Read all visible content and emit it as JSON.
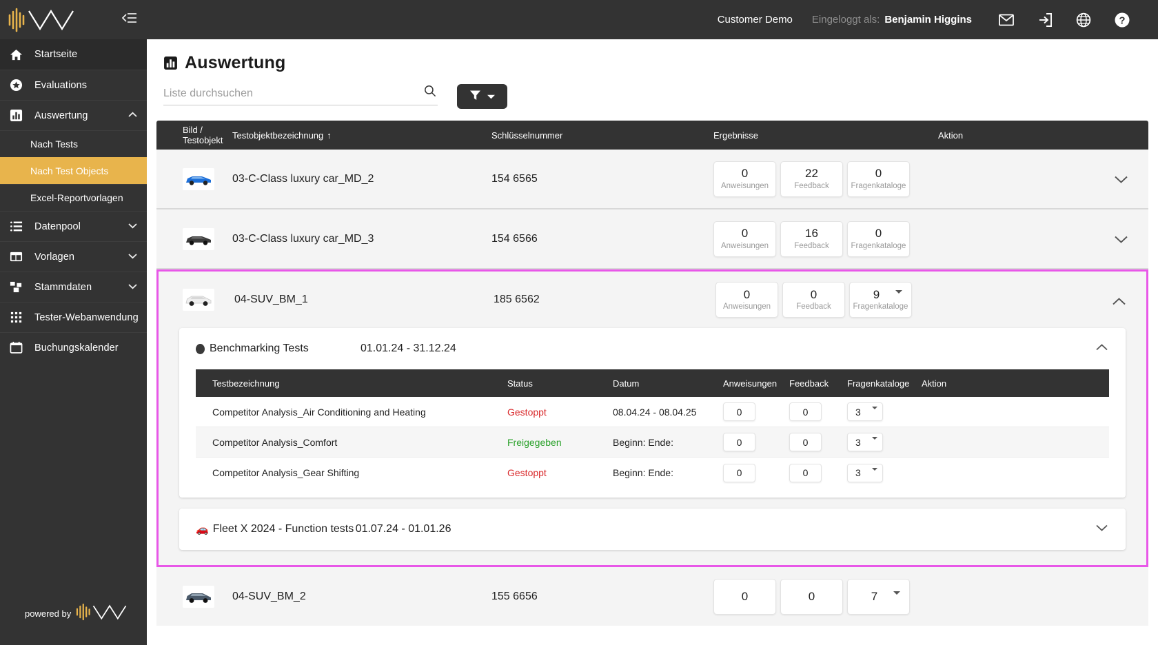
{
  "sidebar": {
    "logo_alt": "brand-logo",
    "collapse_icon": "collapse-sidebar-icon",
    "items": [
      {
        "label": "Startseite",
        "icon": "home-icon",
        "expandable": false
      },
      {
        "label": "Evaluations",
        "icon": "star-icon",
        "expandable": false
      },
      {
        "label": "Auswertung",
        "icon": "bar-chart-icon",
        "expandable": true,
        "expanded": true
      }
    ],
    "subitems": [
      {
        "label": "Nach Tests",
        "active": false
      },
      {
        "label": "Nach Test Objects",
        "active": true
      },
      {
        "label": "Excel-Reportvorlagen",
        "active": false
      }
    ],
    "items2": [
      {
        "label": "Datenpool",
        "icon": "list-icon",
        "expandable": true
      },
      {
        "label": "Vorlagen",
        "icon": "template-icon",
        "expandable": true
      },
      {
        "label": "Stammdaten",
        "icon": "hierarchy-icon",
        "expandable": true
      },
      {
        "label": "Tester-Webanwendung",
        "icon": "grid-icon",
        "expandable": false
      },
      {
        "label": "Buchungskalender",
        "icon": "calendar-icon",
        "expandable": false
      }
    ],
    "footer": {
      "powered_by": "powered by"
    }
  },
  "topbar": {
    "customer": "Customer Demo",
    "logged_in_label": "Eingeloggt als:",
    "user_name": "Benjamin Higgins",
    "icons": [
      "mail-icon",
      "logout-icon",
      "globe-icon",
      "help-icon"
    ]
  },
  "page": {
    "title": "Auswertung",
    "title_icon": "bar-chart-icon"
  },
  "search": {
    "placeholder": "Liste durchsuchen",
    "value": "",
    "icon": "search-icon"
  },
  "filter_button": {
    "icon": "filter-icon",
    "caret": "chevron-down-icon"
  },
  "table": {
    "columns": [
      "Bild / Testobjekt",
      "Testobjektbezeichnung",
      "Schlüsselnummer",
      "Ergebnisse",
      "Aktion"
    ],
    "sort_indicator": "↑",
    "sorted_column": "Testobjektbezeichnung",
    "rows": [
      {
        "name": "03-C-Class luxury car_MD_2",
        "key_number": "154 6565",
        "thumb_color": "#1d6fd8",
        "results": [
          {
            "value": "0",
            "label": "Anweisungen",
            "dropdown": false
          },
          {
            "value": "22",
            "label": "Feedback",
            "dropdown": false
          },
          {
            "value": "0",
            "label": "Fragenkataloge",
            "dropdown": false
          }
        ],
        "expanded": false,
        "selected": false
      },
      {
        "name": "03-C-Class luxury car_MD_3",
        "key_number": "154 6566",
        "thumb_color": "#3a3a3a",
        "results": [
          {
            "value": "0",
            "label": "Anweisungen",
            "dropdown": false
          },
          {
            "value": "16",
            "label": "Feedback",
            "dropdown": false
          },
          {
            "value": "0",
            "label": "Fragenkataloge",
            "dropdown": false
          }
        ],
        "expanded": false,
        "selected": false
      },
      {
        "name": "04-SUV_BM_1",
        "key_number": "185 6562",
        "thumb_color": "#e8e8e8",
        "results": [
          {
            "value": "0",
            "label": "Anweisungen",
            "dropdown": false
          },
          {
            "value": "0",
            "label": "Feedback",
            "dropdown": false
          },
          {
            "value": "9",
            "label": "Fragenkataloge",
            "dropdown": true
          }
        ],
        "expanded": true,
        "selected": true
      },
      {
        "name": "04-SUV_BM_2",
        "key_number": "155 6656",
        "thumb_color": "#4a5a6a",
        "results": [
          {
            "value": "0",
            "label": "",
            "dropdown": false
          },
          {
            "value": "0",
            "label": "",
            "dropdown": false
          },
          {
            "value": "7",
            "label": "",
            "dropdown": true
          }
        ],
        "expanded": false,
        "selected": false
      }
    ]
  },
  "expanded_panel": {
    "groups": [
      {
        "marker": "dot",
        "title": "Benchmarking Tests",
        "date_range": "01.01.24 - 31.12.24",
        "expanded": true,
        "sub_columns": [
          "Testbezeichnung",
          "Status",
          "Datum",
          "Anweisungen",
          "Feedback",
          "Fragenkataloge",
          "Aktion"
        ],
        "sub_rows": [
          {
            "name": "Competitor Analysis_Air Conditioning and Heating",
            "status": "Gestoppt",
            "status_type": "stopped",
            "date": "08.04.24 - 08.04.25",
            "anweisungen": "0",
            "feedback": "0",
            "fragenkataloge": "3"
          },
          {
            "name": "Competitor Analysis_Comfort",
            "status": "Freigegeben",
            "status_type": "released",
            "date": "Beginn: Ende:",
            "anweisungen": "0",
            "feedback": "0",
            "fragenkataloge": "3"
          },
          {
            "name": "Competitor Analysis_Gear Shifting",
            "status": "Gestoppt",
            "status_type": "stopped",
            "date": "Beginn: Ende:",
            "anweisungen": "0",
            "feedback": "0",
            "fragenkataloge": "3"
          }
        ]
      },
      {
        "marker": "car",
        "marker_emoji": "🚗",
        "title": "Fleet X 2024 - Function tests",
        "date_range": "01.07.24 - 01.01.26",
        "expanded": false,
        "sub_columns": [],
        "sub_rows": []
      }
    ]
  },
  "colors": {
    "sidebar_bg": "#333333",
    "accent_yellow": "#e8b44c",
    "selection_magenta": "#e857e8",
    "status_stopped": "#d9292b",
    "status_released": "#2aa12a",
    "row_bg": "#f4f4f4"
  }
}
